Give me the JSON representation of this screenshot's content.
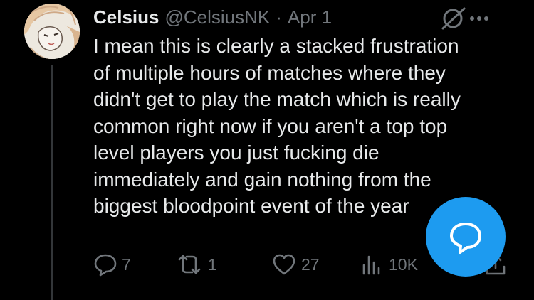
{
  "tweet": {
    "display_name": "Celsius",
    "handle": "@CelsiusNK",
    "separator": "·",
    "date": "Apr 1",
    "text": "I mean this is clearly a stacked frustration\nof multiple hours of matches where they\ndidn't get to play the match which is really\ncommon right now if you aren't a top top\nlevel players you just fucking die\nimmediately and gain nothing from the\nbiggest bloodpoint event of the year"
  },
  "header_icons": [
    "grok-icon",
    "more-icon"
  ],
  "actions": {
    "replies": "7",
    "reposts": "1",
    "likes": "27",
    "views": "10K"
  },
  "compose_fab": {
    "icon": "reply-bubble-icon"
  },
  "colors": {
    "background": "#000000",
    "text": "#e7e9ea",
    "muted": "#71767b",
    "accent": "#1d9bf0",
    "thread_line": "#333639"
  }
}
